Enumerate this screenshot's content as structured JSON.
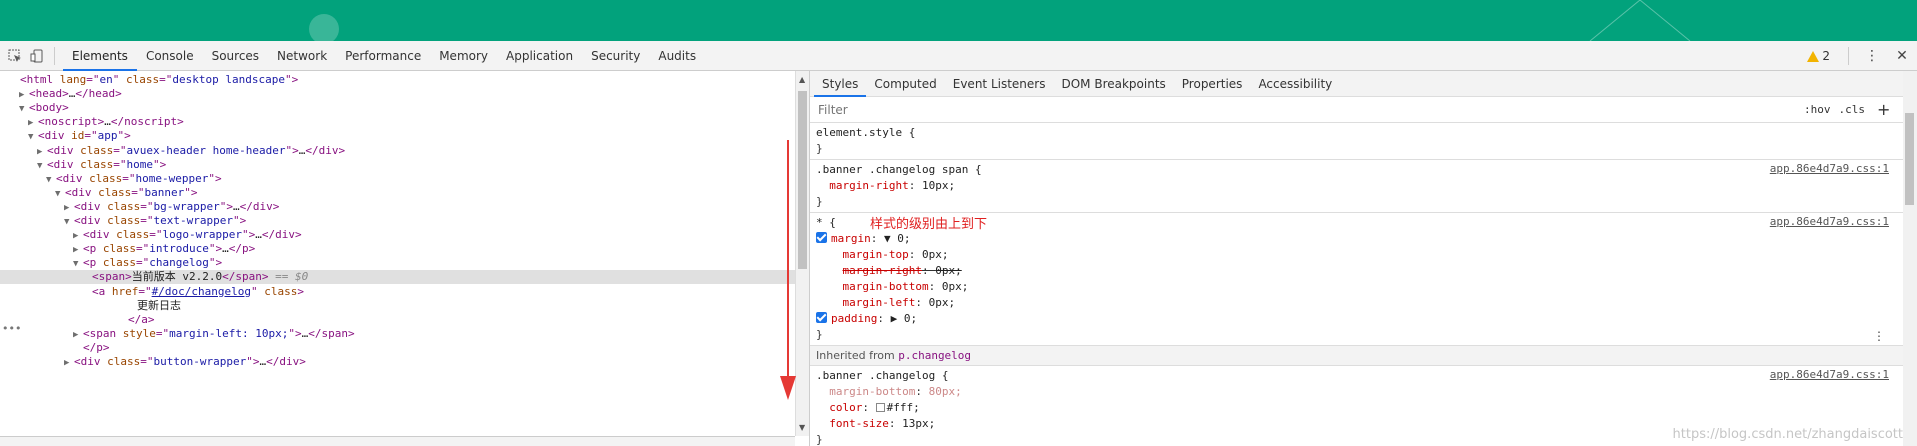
{
  "devtools": {
    "tabs": [
      "Elements",
      "Console",
      "Sources",
      "Network",
      "Performance",
      "Memory",
      "Application",
      "Security",
      "Audits"
    ],
    "active_tab": "Elements",
    "warning_count": "2"
  },
  "elements_panel": {
    "lines": [
      {
        "indent": 0,
        "tri": "",
        "parts": [
          [
            "tag",
            "<html "
          ],
          [
            "attr",
            "lang"
          ],
          [
            "tag",
            "=\""
          ],
          [
            "val",
            "en"
          ],
          [
            "tag",
            "\" "
          ],
          [
            "attr",
            "class"
          ],
          [
            "tag",
            "=\""
          ],
          [
            "val",
            "desktop landscape"
          ],
          [
            "tag",
            "\">"
          ]
        ]
      },
      {
        "indent": 1,
        "tri": "▶",
        "parts": [
          [
            "tag",
            "<head>"
          ],
          [
            "txt",
            "…"
          ],
          [
            "tag",
            "</head>"
          ]
        ]
      },
      {
        "indent": 1,
        "tri": "▼",
        "parts": [
          [
            "tag",
            "<body>"
          ]
        ]
      },
      {
        "indent": 2,
        "tri": "▶",
        "parts": [
          [
            "tag",
            "<noscript>"
          ],
          [
            "txt",
            "…"
          ],
          [
            "tag",
            "</noscript>"
          ]
        ]
      },
      {
        "indent": 2,
        "tri": "▼",
        "parts": [
          [
            "tag",
            "<div "
          ],
          [
            "attr",
            "id"
          ],
          [
            "tag",
            "=\""
          ],
          [
            "val",
            "app"
          ],
          [
            "tag",
            "\">"
          ]
        ]
      },
      {
        "indent": 3,
        "tri": "▶",
        "parts": [
          [
            "tag",
            "<div "
          ],
          [
            "attr",
            "class"
          ],
          [
            "tag",
            "=\""
          ],
          [
            "val",
            "avuex-header home-header"
          ],
          [
            "tag",
            "\">"
          ],
          [
            "txt",
            "…"
          ],
          [
            "tag",
            "</div>"
          ]
        ]
      },
      {
        "indent": 3,
        "tri": "▼",
        "parts": [
          [
            "tag",
            "<div "
          ],
          [
            "attr",
            "class"
          ],
          [
            "tag",
            "=\""
          ],
          [
            "val",
            "home"
          ],
          [
            "tag",
            "\">"
          ]
        ]
      },
      {
        "indent": 4,
        "tri": "▼",
        "parts": [
          [
            "tag",
            "<div "
          ],
          [
            "attr",
            "class"
          ],
          [
            "tag",
            "=\""
          ],
          [
            "val",
            "home-wepper"
          ],
          [
            "tag",
            "\">"
          ]
        ]
      },
      {
        "indent": 5,
        "tri": "▼",
        "parts": [
          [
            "tag",
            "<div "
          ],
          [
            "attr",
            "class"
          ],
          [
            "tag",
            "=\""
          ],
          [
            "val",
            "banner"
          ],
          [
            "tag",
            "\">"
          ]
        ]
      },
      {
        "indent": 6,
        "tri": "▶",
        "parts": [
          [
            "tag",
            "<div "
          ],
          [
            "attr",
            "class"
          ],
          [
            "tag",
            "=\""
          ],
          [
            "val",
            "bg-wrapper"
          ],
          [
            "tag",
            "\">"
          ],
          [
            "txt",
            "…"
          ],
          [
            "tag",
            "</div>"
          ]
        ]
      },
      {
        "indent": 6,
        "tri": "▼",
        "parts": [
          [
            "tag",
            "<div "
          ],
          [
            "attr",
            "class"
          ],
          [
            "tag",
            "=\""
          ],
          [
            "val",
            "text-wrapper"
          ],
          [
            "tag",
            "\">"
          ]
        ]
      },
      {
        "indent": 7,
        "tri": "▶",
        "parts": [
          [
            "tag",
            "<div "
          ],
          [
            "attr",
            "class"
          ],
          [
            "tag",
            "=\""
          ],
          [
            "val",
            "logo-wrapper"
          ],
          [
            "tag",
            "\">"
          ],
          [
            "txt",
            "…"
          ],
          [
            "tag",
            "</div>"
          ]
        ]
      },
      {
        "indent": 7,
        "tri": "▶",
        "parts": [
          [
            "tag",
            "<p "
          ],
          [
            "attr",
            "class"
          ],
          [
            "tag",
            "=\""
          ],
          [
            "val",
            "introduce"
          ],
          [
            "tag",
            "\">"
          ],
          [
            "txt",
            "…"
          ],
          [
            "tag",
            "</p>"
          ]
        ]
      },
      {
        "indent": 7,
        "tri": "▼",
        "parts": [
          [
            "tag",
            "<p "
          ],
          [
            "attr",
            "class"
          ],
          [
            "tag",
            "=\""
          ],
          [
            "val",
            "changelog"
          ],
          [
            "tag",
            "\">"
          ]
        ]
      },
      {
        "indent": 8,
        "tri": "",
        "selected": true,
        "parts": [
          [
            "tag",
            "<span>"
          ],
          [
            "txt",
            "当前版本 v2.2.0"
          ],
          [
            "tag",
            "</span>"
          ],
          [
            "dollar",
            " == $0"
          ]
        ]
      },
      {
        "indent": 8,
        "tri": "",
        "parts": [
          [
            "tag",
            "<a "
          ],
          [
            "attr",
            "href"
          ],
          [
            "tag",
            "=\""
          ],
          [
            "link",
            "#/doc/changelog"
          ],
          [
            "tag",
            "\" "
          ],
          [
            "attr",
            "class"
          ],
          [
            "tag",
            ">"
          ]
        ]
      },
      {
        "indent": 13,
        "tri": "",
        "parts": [
          [
            "txt",
            "更新日志"
          ]
        ]
      },
      {
        "indent": 12,
        "tri": "",
        "parts": [
          [
            "tag",
            "</a>"
          ]
        ]
      },
      {
        "indent": 7,
        "tri": "▶",
        "parts": [
          [
            "tag",
            "<span "
          ],
          [
            "attr",
            "style"
          ],
          [
            "tag",
            "=\""
          ],
          [
            "val",
            "margin-left: 10px;"
          ],
          [
            "tag",
            "\">"
          ],
          [
            "txt",
            "…"
          ],
          [
            "tag",
            "</span>"
          ]
        ]
      },
      {
        "indent": 7,
        "tri": "",
        "parts": [
          [
            "tag",
            "</p>"
          ]
        ]
      },
      {
        "indent": 6,
        "tri": "▶",
        "parts": [
          [
            "tag",
            "<div "
          ],
          [
            "attr",
            "class"
          ],
          [
            "tag",
            "=\""
          ],
          [
            "val",
            "button-wrapper"
          ],
          [
            "tag",
            "\">"
          ],
          [
            "txt",
            "…"
          ],
          [
            "tag",
            "</div>"
          ]
        ]
      }
    ]
  },
  "styles_panel": {
    "tabs": [
      "Styles",
      "Computed",
      "Event Listeners",
      "DOM Breakpoints",
      "Properties",
      "Accessibility"
    ],
    "active_tab": "Styles",
    "filter_placeholder": "Filter",
    "hov_label": ":hov",
    "cls_label": ".cls",
    "plus_label": "+",
    "element_style": {
      "selector": "element.style {",
      "close": "}"
    },
    "rule1": {
      "selector": ".banner .changelog span {",
      "source": "app.86e4d7a9.css:1",
      "prop": "margin-right",
      "value": "10px;",
      "close": "}"
    },
    "rule2": {
      "selector": "* {",
      "source": "app.86e4d7a9.css:1",
      "annotation": "样式的级别由上到下",
      "margin_prop": "margin",
      "margin_value": "▼ 0;",
      "subs": [
        {
          "prop": "margin-top",
          "value": "0px;",
          "struck": false
        },
        {
          "prop": "margin-right",
          "value": "0px;",
          "struck": true
        },
        {
          "prop": "margin-bottom",
          "value": "0px;",
          "struck": false
        },
        {
          "prop": "margin-left",
          "value": "0px;",
          "struck": false
        }
      ],
      "padding_prop": "padding",
      "padding_value": "▶ 0;",
      "close": "}"
    },
    "inherited_label": "Inherited from",
    "inherited_ref": "p.changelog",
    "rule3": {
      "selector": ".banner .changelog {",
      "source": "app.86e4d7a9.css:1",
      "faded_prop": "margin-bottom",
      "faded_value": "80px;",
      "color_prop": "color",
      "color_value": "#fff;",
      "font_prop": "font-size",
      "font_value": "13px;",
      "close": "}"
    }
  },
  "watermark": "https://blog.csdn.net/zhangdaiscott",
  "colors": {
    "banner_green": "#02a27c",
    "arrow_red": "#e53935"
  }
}
